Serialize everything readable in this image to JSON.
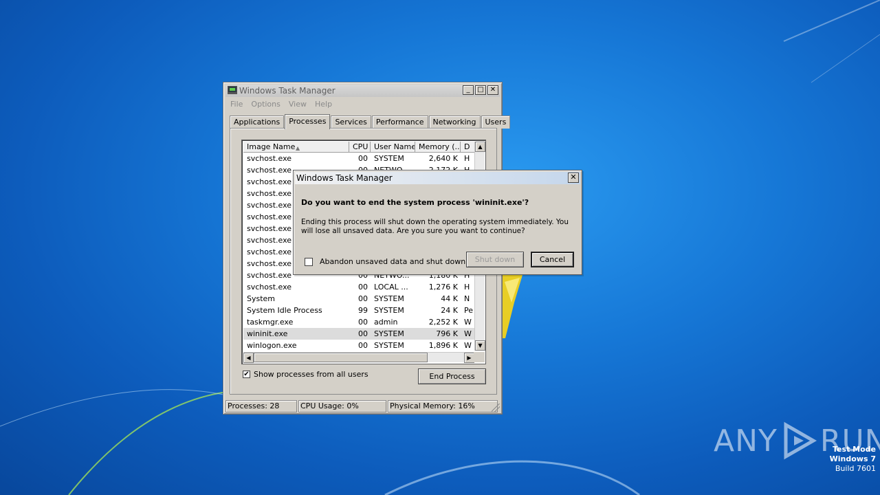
{
  "taskmgr": {
    "title": "Windows Task Manager",
    "caption_buttons": [
      "_",
      "□",
      "✕"
    ],
    "menu": [
      "File",
      "Options",
      "View",
      "Help"
    ],
    "tabs": [
      "Applications",
      "Processes",
      "Services",
      "Performance",
      "Networking",
      "Users"
    ],
    "active_tab": "Processes",
    "columns": [
      "Image Name",
      "CPU",
      "User Name",
      "Memory (...",
      "D"
    ],
    "rows": [
      {
        "name": "svchost.exe",
        "cpu": "00",
        "user": "SYSTEM",
        "mem": "2,640 K",
        "desc": "H"
      },
      {
        "name": "svchost.exe",
        "cpu": "00",
        "user": "NETWO...",
        "mem": "2,172 K",
        "desc": "H"
      },
      {
        "name": "svchost.exe",
        "cpu": "",
        "user": "",
        "mem": "",
        "desc": ""
      },
      {
        "name": "svchost.exe",
        "cpu": "",
        "user": "",
        "mem": "",
        "desc": ""
      },
      {
        "name": "svchost.exe",
        "cpu": "",
        "user": "",
        "mem": "",
        "desc": ""
      },
      {
        "name": "svchost.exe",
        "cpu": "",
        "user": "",
        "mem": "",
        "desc": ""
      },
      {
        "name": "svchost.exe",
        "cpu": "",
        "user": "",
        "mem": "",
        "desc": ""
      },
      {
        "name": "svchost.exe",
        "cpu": "",
        "user": "",
        "mem": "",
        "desc": ""
      },
      {
        "name": "svchost.exe",
        "cpu": "",
        "user": "",
        "mem": "",
        "desc": ""
      },
      {
        "name": "svchost.exe",
        "cpu": "",
        "user": "",
        "mem": "",
        "desc": ""
      },
      {
        "name": "svchost.exe",
        "cpu": "00",
        "user": "NETWO...",
        "mem": "1,180 K",
        "desc": "H"
      },
      {
        "name": "svchost.exe",
        "cpu": "00",
        "user": "LOCAL ...",
        "mem": "1,276 K",
        "desc": "H"
      },
      {
        "name": "System",
        "cpu": "00",
        "user": "SYSTEM",
        "mem": "44 K",
        "desc": "N"
      },
      {
        "name": "System Idle Process",
        "cpu": "99",
        "user": "SYSTEM",
        "mem": "24 K",
        "desc": "Pe"
      },
      {
        "name": "taskmgr.exe",
        "cpu": "00",
        "user": "admin",
        "mem": "2,252 K",
        "desc": "W"
      },
      {
        "name": "wininit.exe",
        "cpu": "00",
        "user": "SYSTEM",
        "mem": "796 K",
        "desc": "W",
        "selected": true
      },
      {
        "name": "winlogon.exe",
        "cpu": "00",
        "user": "SYSTEM",
        "mem": "1,896 K",
        "desc": "W"
      }
    ],
    "show_all_label": "Show processes from all users",
    "show_all_checked": true,
    "end_process_label": "End Process",
    "status": {
      "processes": "Processes: 28",
      "cpu": "CPU Usage: 0%",
      "memory": "Physical Memory: 16%"
    }
  },
  "dialog": {
    "title": "Windows Task Manager",
    "close_glyph": "✕",
    "question": "Do you want to end the system process 'wininit.exe'?",
    "message": "Ending this process will shut down the operating system immediately.  You will lose all unsaved data.  Are you sure you want to continue?",
    "checkbox_label": "Abandon unsaved data and shut down.",
    "checkbox_checked": false,
    "shutdown_label": "Shut down",
    "cancel_label": "Cancel"
  },
  "watermark": {
    "brand_left": "ANY",
    "brand_right": "RUN",
    "line1": "Test Mode",
    "line2": "Windows 7",
    "line3": "Build 7601"
  }
}
